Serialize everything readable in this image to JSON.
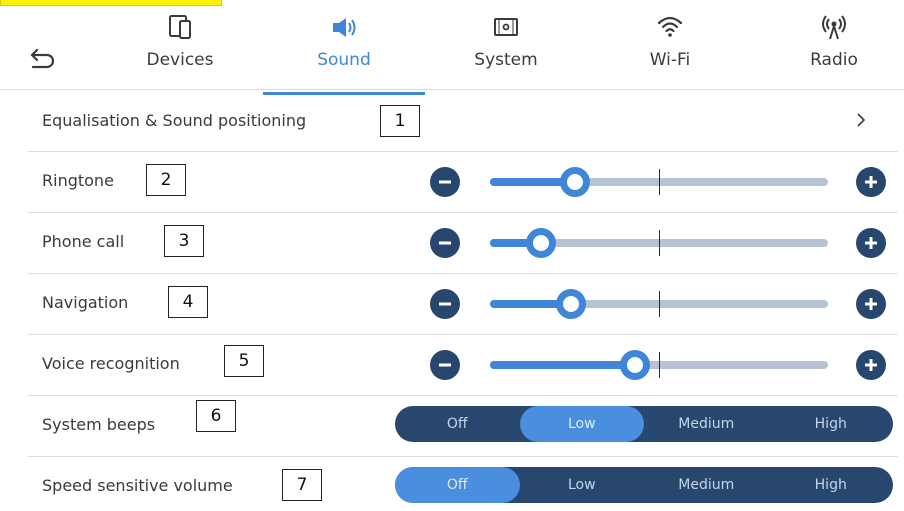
{
  "header": {
    "tabs": [
      {
        "label": "Devices",
        "icon": "devices-icon"
      },
      {
        "label": "Sound",
        "icon": "speaker-icon",
        "active": true
      },
      {
        "label": "System",
        "icon": "system-icon"
      },
      {
        "label": "Wi-Fi",
        "icon": "wifi-icon"
      },
      {
        "label": "Radio",
        "icon": "radio-icon"
      }
    ]
  },
  "rows": {
    "equalisation": {
      "label": "Equalisation & Sound positioning",
      "callout": "1"
    },
    "ringtone": {
      "label": "Ringtone",
      "callout": "2",
      "level": 0.25
    },
    "phone_call": {
      "label": "Phone call",
      "callout": "3",
      "level": 0.15
    },
    "navigation": {
      "label": "Navigation",
      "callout": "4",
      "level": 0.24
    },
    "voice_recognition": {
      "label": "Voice recognition",
      "callout": "5",
      "level": 0.43
    },
    "system_beeps": {
      "label": "System beeps",
      "callout": "6",
      "options": [
        "Off",
        "Low",
        "Medium",
        "High"
      ],
      "selected": "Low"
    },
    "speed_sensitive_volume": {
      "label": "Speed sensitive volume",
      "callout": "7",
      "options": [
        "Off",
        "Low",
        "Medium",
        "High"
      ],
      "selected": "Off"
    }
  },
  "colors": {
    "accent": "#3f86d8",
    "dark_navy": "#27476f",
    "track": "#b7c3d2"
  }
}
